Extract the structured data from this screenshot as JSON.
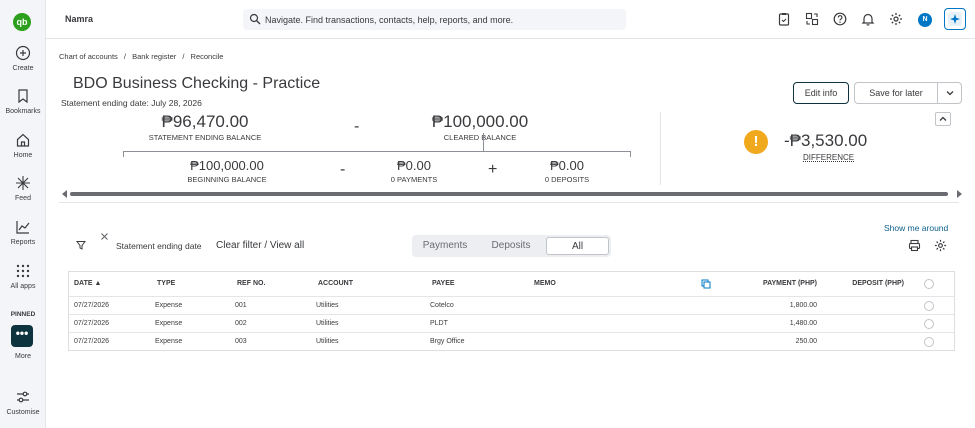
{
  "app": {
    "logo": "qb",
    "company": "Namra"
  },
  "search": {
    "placeholder": "Navigate. Find transactions, contacts, help, reports, and more."
  },
  "user": {
    "initial": "N"
  },
  "rail": {
    "items": [
      {
        "label": "Create",
        "icon": "plus-circle-icon"
      },
      {
        "label": "Bookmarks",
        "icon": "bookmark-icon"
      },
      {
        "label": "Home",
        "icon": "home-icon"
      },
      {
        "label": "Feed",
        "icon": "sparkle-icon"
      },
      {
        "label": "Reports",
        "icon": "chart-icon"
      },
      {
        "label": "All apps",
        "icon": "grid-icon"
      }
    ],
    "pinned_label": "PINNED",
    "more_label": "More",
    "more_glyph": "•••",
    "customise_label": "Customise"
  },
  "breadcrumb": [
    "Chart of accounts",
    "/",
    "Bank register",
    "/",
    "Reconcile"
  ],
  "page": {
    "title": "BDO Business Checking - Practice",
    "statement_date": "Statement ending date: July 28, 2026",
    "edit_info": "Edit info",
    "save_for_later": "Save for later"
  },
  "summary": {
    "ending_balance": "₱96,470.00",
    "ending_balance_label": "STATEMENT ENDING BALANCE",
    "minus": "-",
    "cleared_balance": "₱100,000.00",
    "cleared_balance_label": "CLEARED BALANCE",
    "beginning_balance": "₱100,000.00",
    "beginning_balance_label": "BEGINNING BALANCE",
    "payments": "₱0.00",
    "payments_label": "0 PAYMENTS",
    "plus": "+",
    "deposits": "₱0.00",
    "deposits_label": "0 DEPOSITS",
    "warn_glyph": "!",
    "difference": "-₱3,530.00",
    "difference_label": "DIFFERENCE"
  },
  "filters": {
    "show_me_around": "Show me around",
    "chip": "Statement ending date",
    "clear": "Clear filter / View all",
    "tabs": [
      "Payments",
      "Deposits",
      "All"
    ],
    "active_tab": "All"
  },
  "table": {
    "columns": [
      "DATE ▲",
      "TYPE",
      "REF NO.",
      "ACCOUNT",
      "PAYEE",
      "MEMO",
      "PAYMENT (PHP)",
      "DEPOSIT (PHP)"
    ],
    "rows": [
      {
        "date": "07/27/2026",
        "type": "Expense",
        "ref": "001",
        "account": "Utilities",
        "payee": "Cotelco",
        "memo": "",
        "payment": "1,800.00",
        "deposit": ""
      },
      {
        "date": "07/27/2026",
        "type": "Expense",
        "ref": "002",
        "account": "Utilities",
        "payee": "PLDT",
        "memo": "",
        "payment": "1,480.00",
        "deposit": ""
      },
      {
        "date": "07/27/2026",
        "type": "Expense",
        "ref": "003",
        "account": "Utilities",
        "payee": "Brgy Office",
        "memo": "",
        "payment": "250.00",
        "deposit": ""
      }
    ]
  }
}
